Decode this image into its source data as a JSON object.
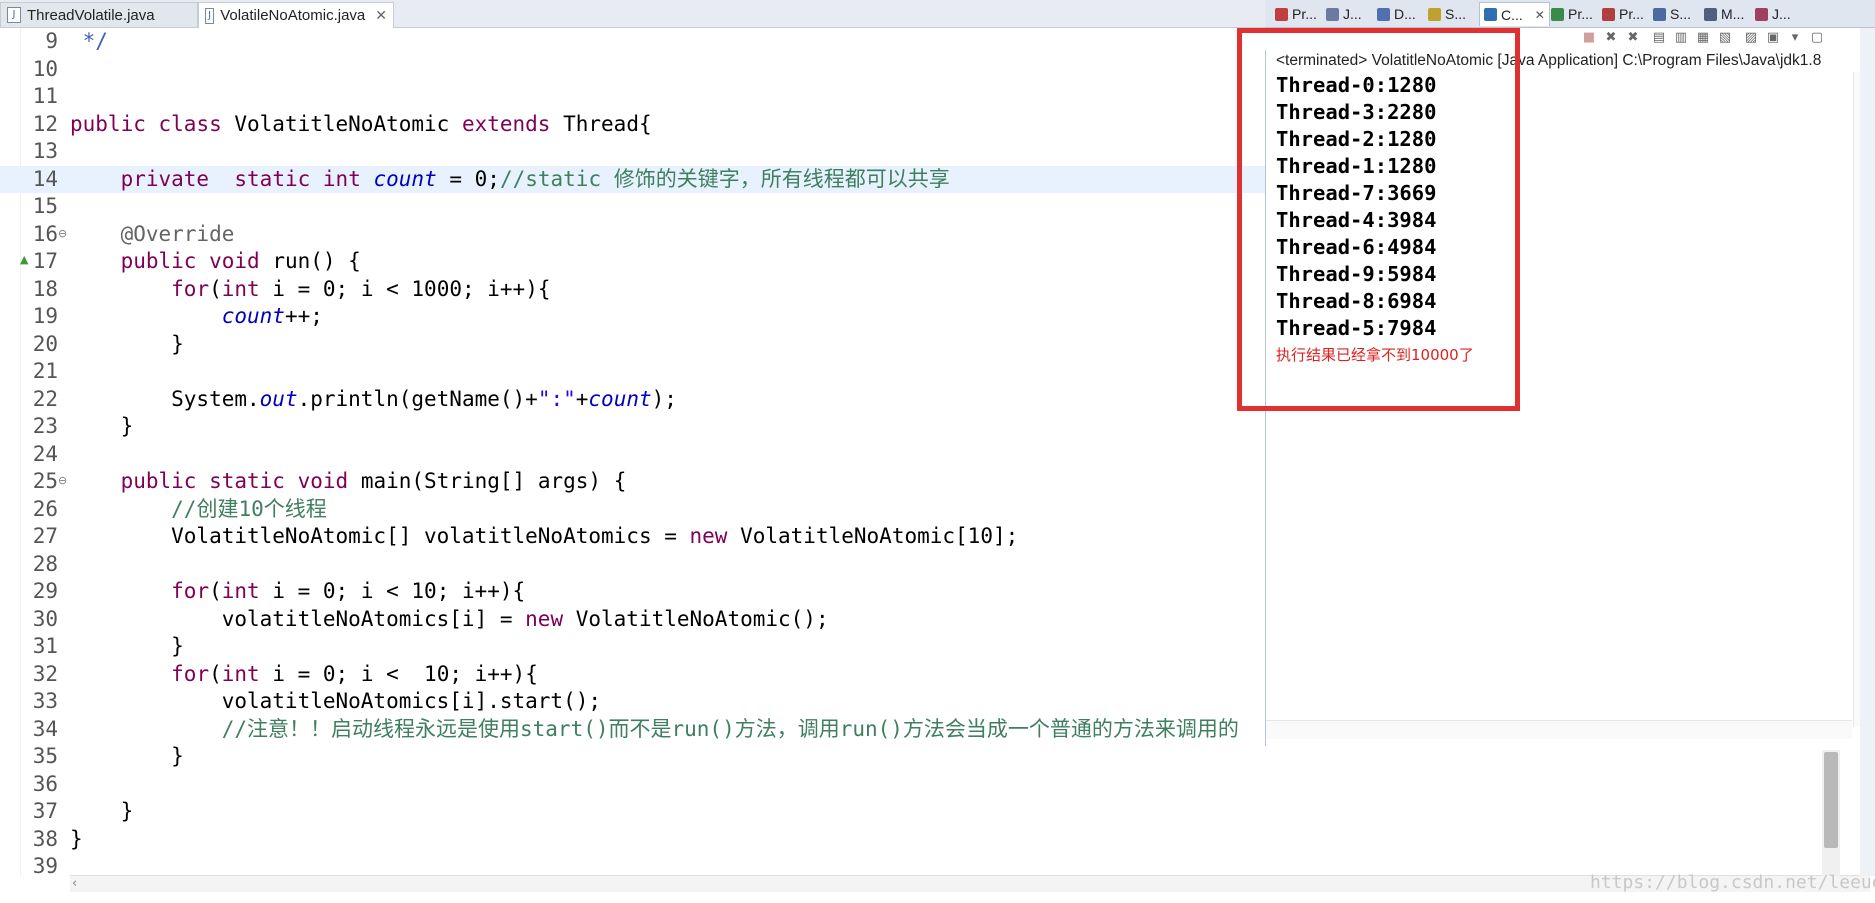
{
  "editor_tabs": [
    {
      "label": "ThreadVolatile.java",
      "active": false
    },
    {
      "label": "VolatileNoAtomic.java",
      "active": true,
      "close": "✕"
    }
  ],
  "console_tabs": [
    {
      "label": "Pr...",
      "icon": "problems-icon"
    },
    {
      "label": "J...",
      "icon": "javadoc-icon"
    },
    {
      "label": "D...",
      "icon": "declaration-icon"
    },
    {
      "label": "S...",
      "icon": "search-icon"
    },
    {
      "label": "C...",
      "icon": "console-icon",
      "active": true,
      "close": "✕"
    },
    {
      "label": "Pr...",
      "icon": "progress-icon"
    },
    {
      "label": "Pr...",
      "icon": "properties-icon"
    },
    {
      "label": "S...",
      "icon": "servers-icon"
    },
    {
      "label": "M...",
      "icon": "markers-icon"
    },
    {
      "label": "J...",
      "icon": "junit-icon"
    }
  ],
  "code_lines": [
    {
      "num": "9",
      "html": " <span class=\"doc\">*/</span>"
    },
    {
      "num": "10",
      "html": ""
    },
    {
      "num": "11",
      "html": ""
    },
    {
      "num": "12",
      "html": "<span class=\"kw\">public</span> <span class=\"kw\">class</span> VolatitleNoAtomic <span class=\"kw\">extends</span> Thread{"
    },
    {
      "num": "13",
      "html": ""
    },
    {
      "num": "14",
      "html": "    <span class=\"kw\">private</span>  <span class=\"kw\">static</span> <span class=\"kw\">int</span> <span class=\"fld\">count</span> = 0;<span class=\"cm\">//static 修饰的关键字，所有线程都可以共享</span>",
      "current": true
    },
    {
      "num": "15",
      "html": ""
    },
    {
      "num": "16",
      "html": "    <span class=\"ann\">@Override</span>",
      "fold": true
    },
    {
      "num": "17",
      "html": "    <span class=\"kw\">public</span> <span class=\"kw\">void</span> run() {",
      "override": true
    },
    {
      "num": "18",
      "html": "        <span class=\"kw\">for</span>(<span class=\"kw\">int</span> i = 0; i &lt; 1000; i++){"
    },
    {
      "num": "19",
      "html": "            <span class=\"fld\">count</span>++;"
    },
    {
      "num": "20",
      "html": "        }"
    },
    {
      "num": "21",
      "html": ""
    },
    {
      "num": "22",
      "html": "        System.<span class=\"fld\">out</span>.println(getName()+<span class=\"str\">\":\"</span>+<span class=\"fld\">count</span>);"
    },
    {
      "num": "23",
      "html": "    }"
    },
    {
      "num": "24",
      "html": ""
    },
    {
      "num": "25",
      "html": "    <span class=\"kw\">public</span> <span class=\"kw\">static</span> <span class=\"kw\">void</span> main(String[] args) {",
      "fold": true
    },
    {
      "num": "26",
      "html": "        <span class=\"cm\">//创建10个线程</span>"
    },
    {
      "num": "27",
      "html": "        VolatitleNoAtomic[] volatitleNoAtomics = <span class=\"kw\">new</span> VolatitleNoAtomic[10];"
    },
    {
      "num": "28",
      "html": ""
    },
    {
      "num": "29",
      "html": "        <span class=\"kw\">for</span>(<span class=\"kw\">int</span> i = 0; i &lt; 10; i++){"
    },
    {
      "num": "30",
      "html": "            volatitleNoAtomics[i] = <span class=\"kw\">new</span> VolatitleNoAtomic();"
    },
    {
      "num": "31",
      "html": "        }"
    },
    {
      "num": "32",
      "html": "        <span class=\"kw\">for</span>(<span class=\"kw\">int</span> i = 0; i &lt;  10; i++){"
    },
    {
      "num": "33",
      "html": "            volatitleNoAtomics[i].start();"
    },
    {
      "num": "34",
      "html": "            <span class=\"cm\">//注意！！启动线程永远是使用start()而不是run()方法，调用run()方法会当成一个普通的方法来调用的</span>"
    },
    {
      "num": "35",
      "html": "        }"
    },
    {
      "num": "36",
      "html": ""
    },
    {
      "num": "37",
      "html": "    }"
    },
    {
      "num": "38",
      "html": "}"
    },
    {
      "num": "39",
      "html": ""
    }
  ],
  "console": {
    "status": "<terminated> VolatitleNoAtomic [Java Application] C:\\Program Files\\Java\\jdk1.8",
    "output": [
      "Thread-0:1280",
      "Thread-3:2280",
      "Thread-2:1280",
      "Thread-1:1280",
      "Thread-7:3669",
      "Thread-4:3984",
      "Thread-6:4984",
      "Thread-9:5984",
      "Thread-8:6984",
      "Thread-5:7984"
    ],
    "note": "执行结果已经拿不到10000了",
    "toolbar_icons": [
      "terminate-icon",
      "remove-launch-icon",
      "remove-all-icon",
      "clear-console-icon",
      "scroll-lock-icon",
      "word-wrap-icon",
      "show-on-output-icon",
      "pin-console-icon",
      "display-console-icon",
      "view-menu-icon",
      "open-console-icon"
    ]
  },
  "watermark": "https://blog.csdn.net/leeue",
  "colors": {
    "keyword": "#7f0055",
    "comment": "#3f7f5f",
    "field": "#0000c0",
    "string": "#2a00ff",
    "highlight_box": "#e03030",
    "note": "#e02020",
    "current_line": "#e8f2fe"
  }
}
